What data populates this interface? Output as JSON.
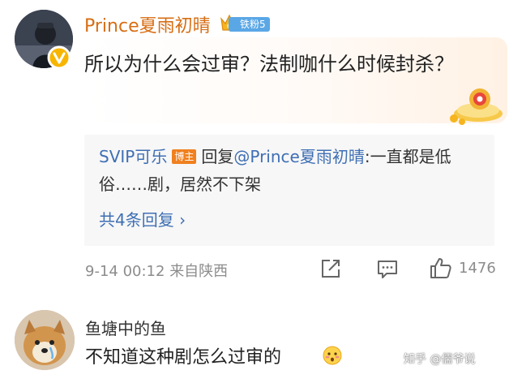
{
  "comment": {
    "author": "Prince夏雨初晴",
    "fan_badge": "铁粉5",
    "text": "所以为什么会过审？法制咖什么时候封杀？",
    "reply": {
      "replier": "SVIP可乐",
      "replier_tag": "博主",
      "reply_prefix": "回复",
      "mention": "@Prince夏雨初晴",
      "text": ":一直都是低俗……剧，居然不下架",
      "count_label": "共4条回复 ›"
    },
    "meta": {
      "time": "9-14 00:12",
      "source": "来自陕西",
      "like_count": "1476"
    }
  },
  "second_comment": {
    "author": "鱼塘中的鱼",
    "text": "不知道这种剧怎么过审的"
  },
  "watermark": "知乎 @儒爷说",
  "colors": {
    "author_orange": "#d76e14",
    "link_blue": "#3f6fb4",
    "badge_blue": "#5aa7e6",
    "tag_orange": "#f0801f",
    "meta_gray": "#8c8c8c",
    "reply_bg": "#f7f7f7"
  },
  "icons": [
    "verified-v-icon",
    "crown-icon",
    "share-icon",
    "comment-icon",
    "thumbs-up-icon",
    "blush-emoji-icon",
    "sticker-icon"
  ]
}
